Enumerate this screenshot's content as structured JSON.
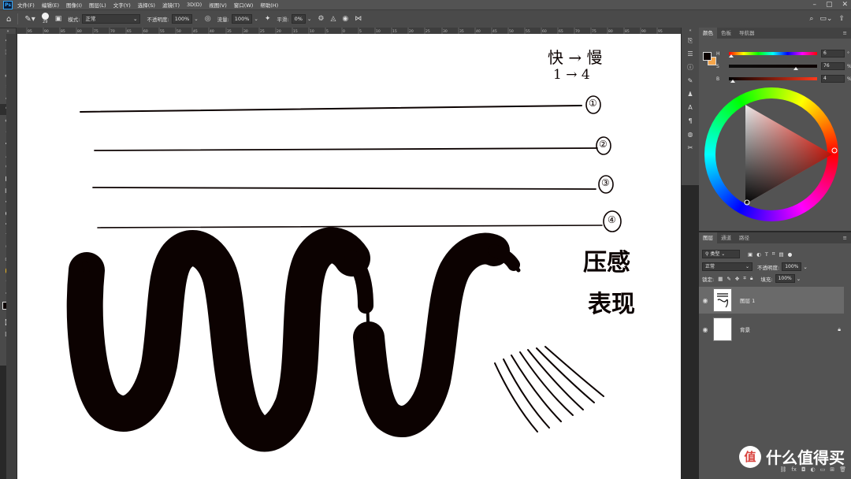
{
  "app": {
    "logo": "Ps"
  },
  "menu": [
    "文件(F)",
    "编辑(E)",
    "图像(I)",
    "图层(L)",
    "文字(Y)",
    "选择(S)",
    "滤镜(T)",
    "3D(D)",
    "视图(V)",
    "窗口(W)",
    "帮助(H)"
  ],
  "options": {
    "brush_size": "29",
    "mode_label": "模式:",
    "mode_value": "正常",
    "opacity_label": "不透明度:",
    "opacity_value": "100%",
    "flow_label": "流量:",
    "flow_value": "100%",
    "smoothing_label": "平滑:",
    "smoothing_value": "0%"
  },
  "ruler_top": [
    "95",
    "90",
    "85",
    "80",
    "75",
    "70",
    "65",
    "60",
    "55",
    "50",
    "45",
    "40",
    "35",
    "30",
    "25",
    "20",
    "15",
    "10",
    "5",
    "0",
    "5",
    "10",
    "15",
    "20",
    "25",
    "30",
    "35",
    "40",
    "45",
    "50",
    "55",
    "60",
    "65",
    "70",
    "75",
    "80",
    "85",
    "90",
    "95"
  ],
  "color_panel": {
    "tabs": [
      "颜色",
      "色板",
      "导航器"
    ],
    "h_label": "H",
    "h_value": "6",
    "h_unit": "°",
    "s_label": "S",
    "s_value": "76",
    "s_unit": "%",
    "b_label": "B",
    "b_value": "4",
    "b_unit": "%",
    "foreground": "#0c0201",
    "background": "#f5a54a"
  },
  "layers_panel": {
    "tabs": [
      "图层",
      "通道",
      "路径"
    ],
    "filter_kind": "类型",
    "blend_mode": "正常",
    "opacity_label": "不透明度:",
    "opacity_value": "100%",
    "lock_label": "锁定:",
    "fill_label": "填充:",
    "fill_value": "100%",
    "layers": [
      {
        "name": "图层 1",
        "selected": true
      },
      {
        "name": "背景",
        "selected": false,
        "locked": true
      }
    ]
  },
  "canvas_text": {
    "line1": "快 → 慢",
    "line2": "1 → 4",
    "labels": [
      "①",
      "②",
      "③",
      "④"
    ],
    "pressure1": "压感",
    "pressure2": "表现"
  },
  "watermark": {
    "badge": "值",
    "text": "什么值得买"
  },
  "colors": {
    "accent": "#31a8ff",
    "ink": "#0c0201",
    "panel": "#535353"
  }
}
